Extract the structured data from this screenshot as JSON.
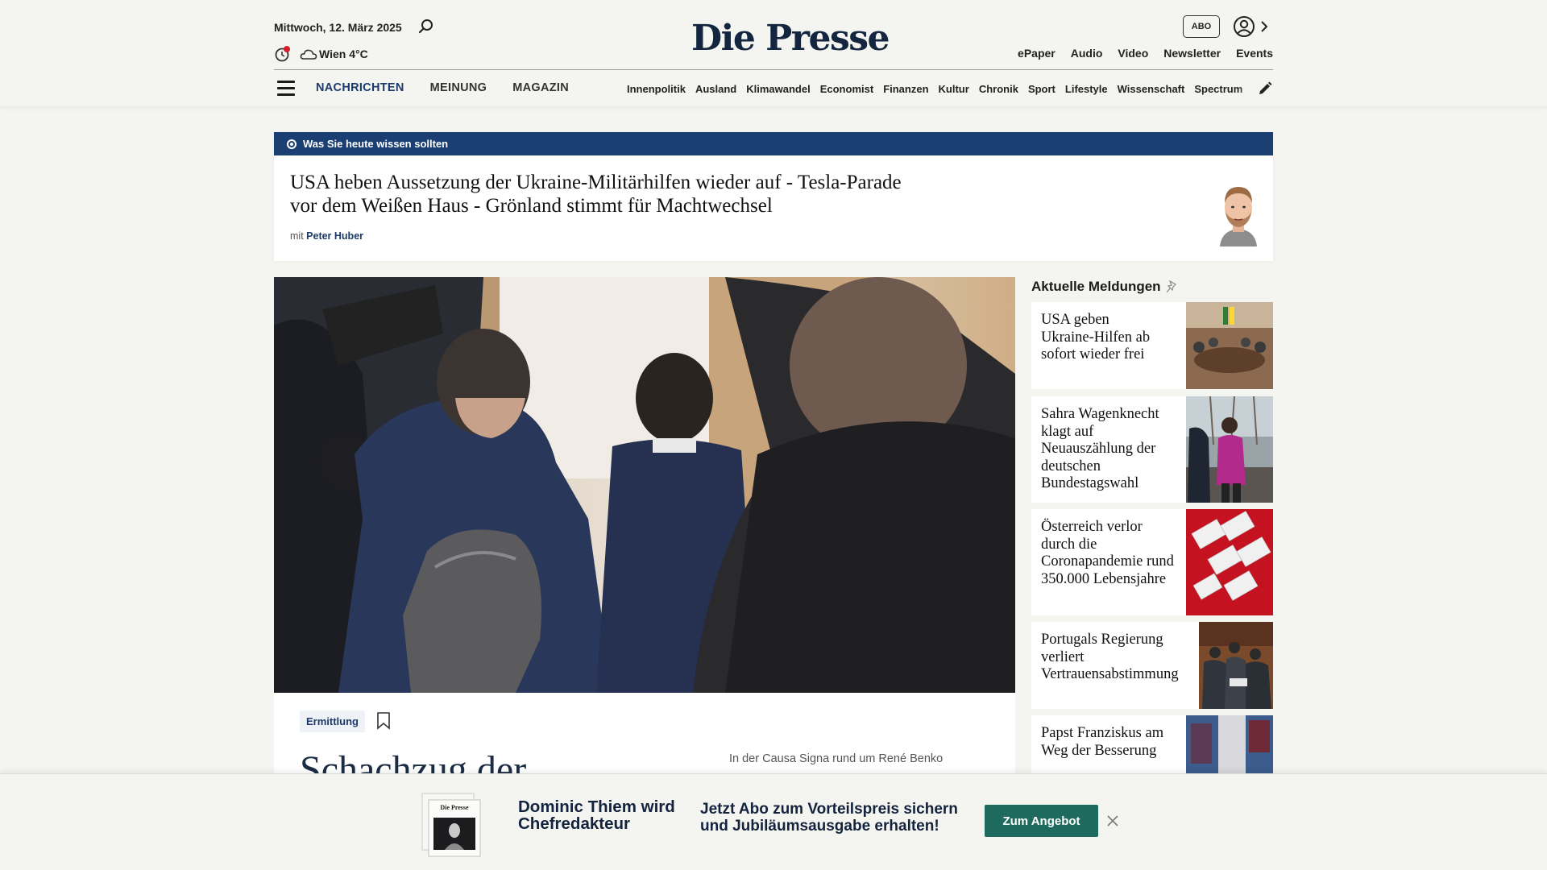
{
  "header": {
    "date": "Mittwoch, 12. März 2025",
    "weather": "Wien 4°C",
    "logo": "Die Presse",
    "abo_label": "ABO",
    "top_links": [
      "ePaper",
      "Audio",
      "Video",
      "Newsletter",
      "Events"
    ],
    "main_nav": [
      "NACHRICHTEN",
      "MEINUNG",
      "MAGAZIN"
    ],
    "sub_nav": [
      "Innenpolitik",
      "Ausland",
      "Klimawandel",
      "Economist",
      "Finanzen",
      "Kultur",
      "Chronik",
      "Sport",
      "Lifestyle",
      "Wissenschaft",
      "Spectrum"
    ],
    "icons": [
      "search-icon",
      "notification-icon",
      "cloud-icon",
      "user-icon",
      "chevron-right-icon",
      "hamburger-icon",
      "pen-icon"
    ]
  },
  "briefing": {
    "bar_label": "Was Sie heute wissen sollten",
    "title": "USA heben Aussetzung der Ukraine-Militärhilfen wieder auf - Tesla-Parade vor dem Weißen Haus - Grönland stimmt für Machtwechsel",
    "byline_prefix": "mit",
    "author": "Peter Huber"
  },
  "hero": {
    "tag": "Ermittlung",
    "headline": "Schachzug der",
    "lead": "In der Causa Signa rund um René Benko"
  },
  "sidebar": {
    "title": "Aktuelle Meldungen",
    "items": [
      {
        "title": "USA geben Ukraine-Hilfen ab sofort wieder frei"
      },
      {
        "title": "Sahra Wagenknecht klagt auf Neuauszählung der deutschen Bundestagswahl"
      },
      {
        "title": "Österreich verlor durch die Coronapandemie rund 350.000 Lebensjahre"
      },
      {
        "title": "Portugals Regierung verliert Vertrauensabstimmung"
      },
      {
        "title": "Papst Franziskus am Weg der Besserung"
      }
    ]
  },
  "promo": {
    "name": "Dominic Thiem wird Chefredakteur",
    "offer": "Jetzt Abo zum Vorteilspreis sichern und Jubiläumsausgabe erhalten!",
    "button": "Zum Angebot",
    "paper_logo": "Die Presse"
  },
  "colors": {
    "brand_navy": "#1b3f73",
    "cta_green": "#1e6a5e",
    "page_bg": "#f4f4f0"
  }
}
